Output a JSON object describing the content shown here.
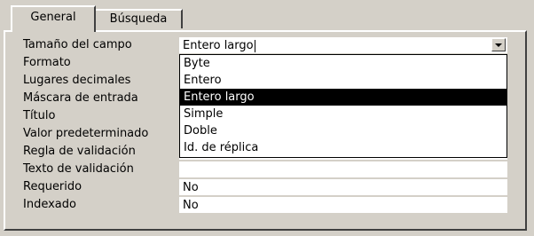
{
  "tabs": [
    {
      "label": "General",
      "active": true
    },
    {
      "label": "Búsqueda",
      "active": false
    }
  ],
  "properties": [
    {
      "label": "Tamaño del campo",
      "value": "Entero largo"
    },
    {
      "label": "Formato",
      "value": ""
    },
    {
      "label": "Lugares decimales",
      "value": ""
    },
    {
      "label": "Máscara de entrada",
      "value": ""
    },
    {
      "label": "Título",
      "value": ""
    },
    {
      "label": "Valor predeterminado",
      "value": ""
    },
    {
      "label": "Regla de validación",
      "value": ""
    },
    {
      "label": "Texto de validación",
      "value": ""
    },
    {
      "label": "Requerido",
      "value": "No"
    },
    {
      "label": "Indexado",
      "value": "No"
    }
  ],
  "dropdown": {
    "options": [
      "Byte",
      "Entero",
      "Entero largo",
      "Simple",
      "Doble",
      "Id. de réplica"
    ],
    "selected": "Entero largo"
  },
  "icons": {
    "combo_arrow": "chevron-down-icon"
  },
  "colors": {
    "face": "#d4d0c8",
    "highlight": "#000000",
    "field": "#ffffff"
  }
}
